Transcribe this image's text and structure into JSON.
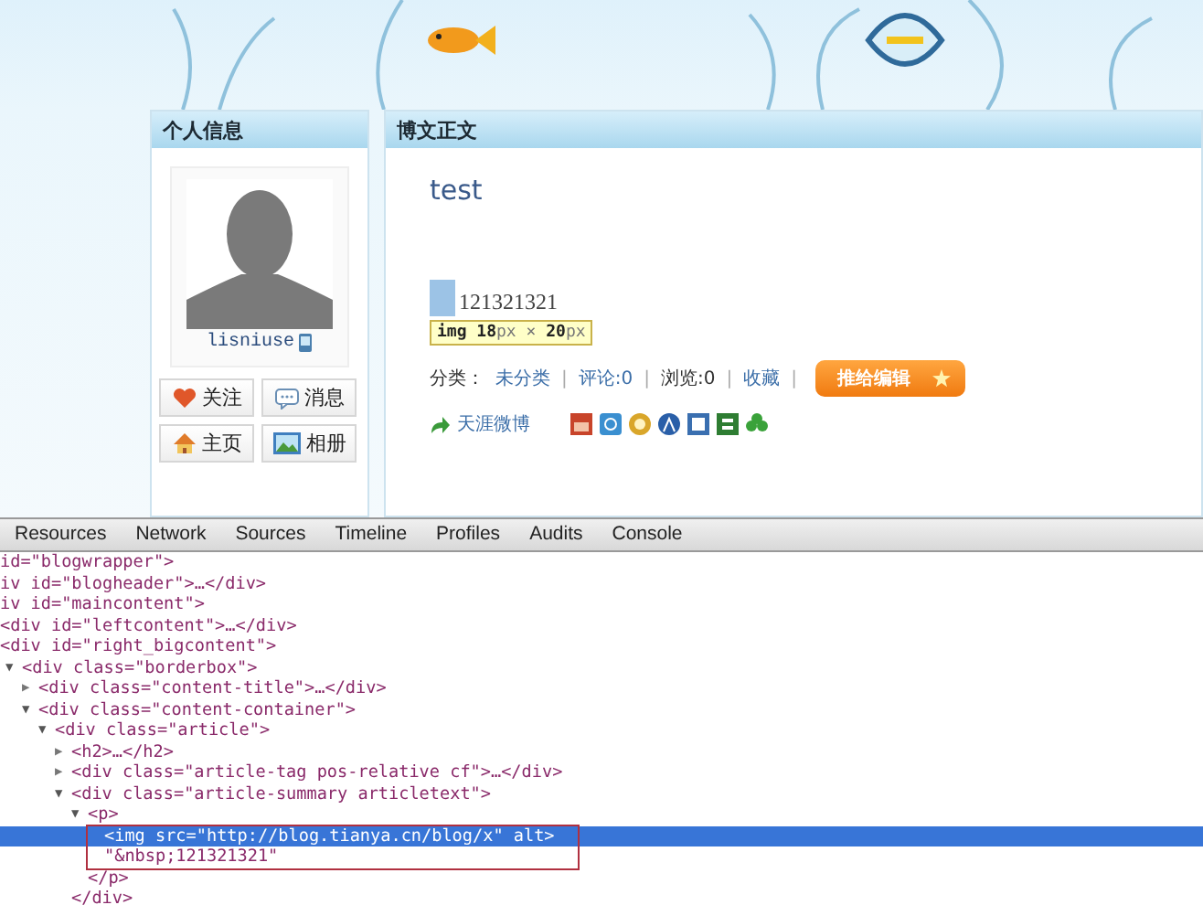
{
  "profile": {
    "title": "个人信息",
    "username": "lisniuse",
    "actions": [
      {
        "label": "关注",
        "kind": "follow"
      },
      {
        "label": "消息",
        "kind": "message"
      },
      {
        "label": "主页",
        "kind": "home"
      },
      {
        "label": "相册",
        "kind": "album"
      }
    ]
  },
  "article_panel": {
    "title": "博文正文",
    "post_title": "test",
    "image_text": "121321321",
    "tooltip": "**img 18**px × **20**px",
    "meta": [
      {
        "text": "分类：",
        "kind": "label"
      },
      {
        "text": "未分类",
        "kind": "link"
      },
      {
        "text": "|",
        "kind": "sep"
      },
      {
        "text": "评论:0",
        "kind": "link"
      },
      {
        "text": "|",
        "kind": "sep"
      },
      {
        "text": "浏览:0",
        "kind": "label"
      },
      {
        "text": "|",
        "kind": "sep"
      },
      {
        "text": "收藏",
        "kind": "link"
      },
      {
        "text": "|",
        "kind": "sep"
      }
    ],
    "forward_button": "推给编辑",
    "weibo_link": "天涯微博"
  },
  "devtools": {
    "tabs": [
      "Resources",
      "Network",
      "Sources",
      "Timeline",
      "Profiles",
      "Audits",
      "Console"
    ],
    "tree": [
      {
        "text": "id=\"blogwrapper\">",
        "selected": false
      },
      {
        "text": "iv id=\"blogheader\">…</div>",
        "selected": false
      },
      {
        "text": "iv id=\"maincontent\">",
        "selected": false
      },
      {
        "text": "<div id=\"leftcontent\">…</div>",
        "selected": false
      },
      {
        "text": "<div id=\"right_bigcontent\">",
        "selected": false,
        "children": [
          {
            "toggle": "▼",
            "text": "<div class=\"borderbox\">",
            "expanded": true,
            "selected": false,
            "children": [
              {
                "toggle": "▶",
                "text": "<div class=\"content-title\">…</div>",
                "expanded": false,
                "selected": false
              },
              {
                "toggle": "▼",
                "text": "<div class=\"content-container\">",
                "expanded": true,
                "selected": false,
                "children": [
                  {
                    "toggle": "▼",
                    "text": "<div class=\"article\">",
                    "expanded": true,
                    "selected": false,
                    "children": [
                      {
                        "toggle": "▶",
                        "text": "<h2>…</h2>",
                        "expanded": false,
                        "selected": false
                      },
                      {
                        "toggle": "▶",
                        "text": "<div class=\"article-tag pos-relative cf\">…</div>",
                        "expanded": false,
                        "selected": false
                      },
                      {
                        "toggle": "▼",
                        "text": "<div class=\"article-summary articletext\">",
                        "expanded": true,
                        "selected": false,
                        "children": [
                          {
                            "toggle": "▼",
                            "text": "<p>",
                            "expanded": true,
                            "selected": false,
                            "children": [
                              {
                                "text": "<img src=\"http://blog.tianya.cn/blog/x\" alt>",
                                "selected": true
                              },
                              {
                                "text": "\"&nbsp;121321321\"",
                                "selected": false
                              }
                            ]
                          },
                          {
                            "text": "</p>",
                            "selected": false
                          }
                        ]
                      },
                      {
                        "text": "</div>",
                        "selected": false
                      }
                    ]
                  }
                ]
              }
            ]
          }
        ]
      }
    ]
  }
}
